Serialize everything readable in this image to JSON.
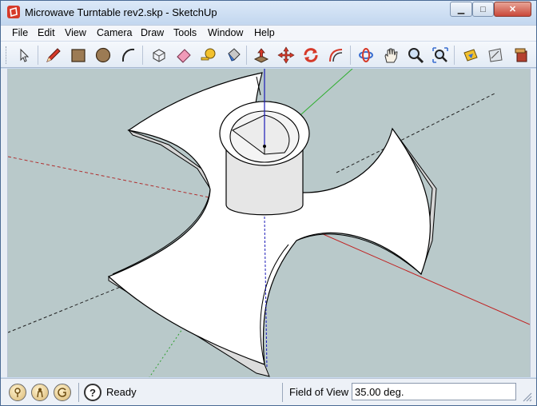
{
  "window": {
    "title": "Microwave Turntable rev2.skp - SketchUp",
    "minimize_glyph": "▁",
    "maximize_glyph": "□",
    "close_glyph": "✕"
  },
  "menu": [
    {
      "label": "File"
    },
    {
      "label": "Edit"
    },
    {
      "label": "View"
    },
    {
      "label": "Camera"
    },
    {
      "label": "Draw"
    },
    {
      "label": "Tools"
    },
    {
      "label": "Window"
    },
    {
      "label": "Help"
    }
  ],
  "toolbar": {
    "tools": [
      "select-icon",
      "line-pencil-icon",
      "rectangle-icon",
      "circle-icon",
      "arc-icon",
      "make-component-icon",
      "eraser-icon",
      "tape-measure-icon",
      "paint-bucket-icon",
      "push-pull-icon",
      "move-icon",
      "rotate-icon",
      "offset-icon",
      "orbit-icon",
      "pan-icon",
      "zoom-icon",
      "zoom-extents-icon",
      "warehouse-icon",
      "share-model-icon",
      "extension-warehouse-icon"
    ]
  },
  "status": {
    "text": "Ready",
    "help_glyph": "?",
    "fov_label": "Field of View",
    "fov_value": "35.00 deg."
  },
  "colors": {
    "viewport_bg": "#b9c9ca",
    "red_axis": "#c02020",
    "green_axis": "#2eae2e",
    "blue_axis": "#1a1ab8",
    "model_face": "#ffffff",
    "model_edge": "#000000"
  }
}
